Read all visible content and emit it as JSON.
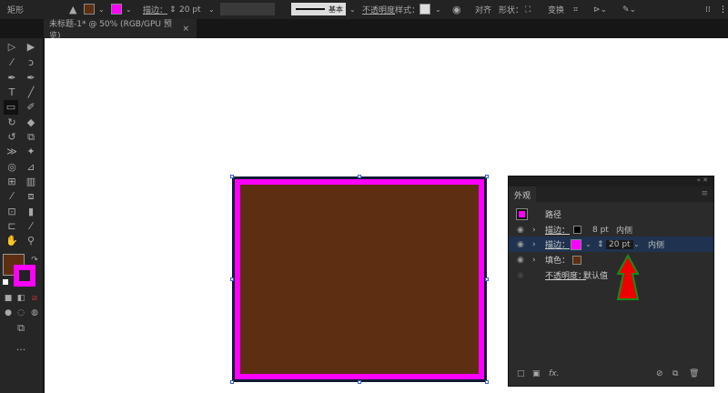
{
  "toolbar": {
    "tool_name": "矩形",
    "stroke_label": "描边：",
    "stroke_weight": "20 pt",
    "profile_label": "基本",
    "opacity_label": "不透明度",
    "style_label": "样式：",
    "align_label": "对齐",
    "shape_label": "形状：",
    "transform_label": "变换"
  },
  "document_tab": {
    "title": "未标题-1* @ 50% (RGB/GPU 预览)",
    "close": "×"
  },
  "colors": {
    "fill": "#5e2e12",
    "stroke": "#ff00ff",
    "canvas": "#ffffff"
  },
  "appearance_panel": {
    "tab": "外观",
    "title": "路径",
    "rows": [
      {
        "label": "描边：",
        "weight": "8 pt",
        "align": "内侧"
      },
      {
        "label": "描边：",
        "weight": "20 pt",
        "align": "内侧"
      },
      {
        "label": "填色："
      },
      {
        "label": "不透明度：",
        "value": "默认值"
      }
    ],
    "fx": "fx."
  },
  "more_tools": "..."
}
